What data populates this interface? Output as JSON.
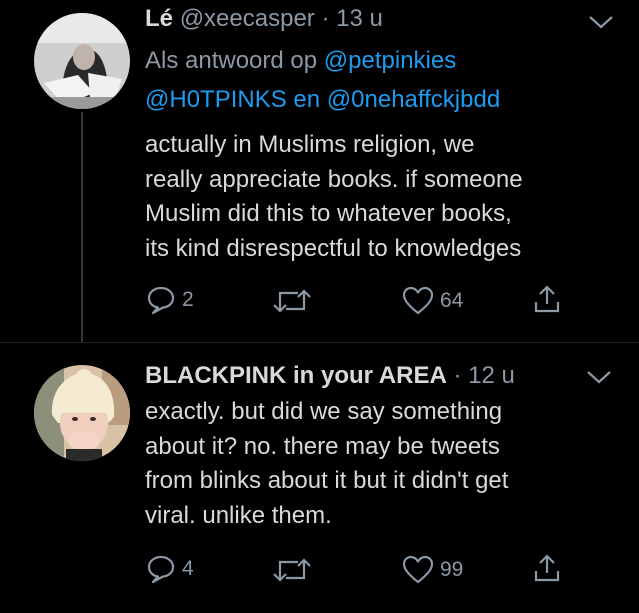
{
  "tweets": [
    {
      "display_name": "Lé",
      "handle": "@xeecasper",
      "separator": "·",
      "time": "13 u",
      "reply_prefix": "Als antwoord op",
      "reply_user_1": "@petpinkies",
      "reply_user_2": "@H0TPINKS",
      "reply_joiner": "en",
      "reply_user_3": "@0nehaffckjbdd",
      "lines": [
        "actually in Muslims religion, we",
        "really appreciate books. if someone",
        "Muslim did this to whatever books,",
        "its kind disrespectful to knowledges"
      ],
      "reply_count": "2",
      "like_count": "64"
    },
    {
      "display_name": "BLACKPINK in your AREA",
      "separator": "·",
      "time": "12 u",
      "lines": [
        "exactly. but did we say something",
        "about it? no. there may be tweets",
        "from blinks about it but it didn't get",
        "viral. unlike them."
      ],
      "reply_count": "4",
      "like_count": "99"
    }
  ],
  "colors": {
    "background": "#000000",
    "text": "#d9d9d9",
    "muted": "#8b98a5",
    "link": "#1d9bf0",
    "thread_line": "#333639"
  },
  "icons": [
    "reply-icon",
    "retweet-icon",
    "like-icon",
    "share-icon",
    "chevron-down-icon"
  ]
}
